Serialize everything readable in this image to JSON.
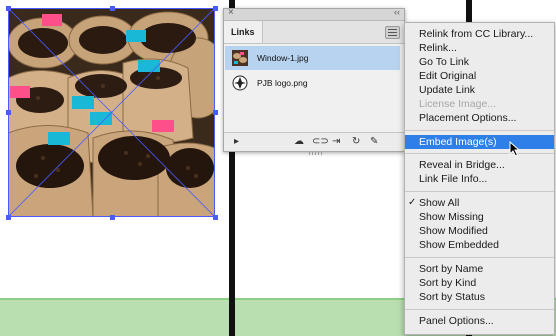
{
  "links_panel": {
    "tab_label": "Links",
    "items": [
      {
        "name": "Window-1.jpg",
        "selected": true
      },
      {
        "name": "PJB logo.png",
        "selected": false
      }
    ],
    "footer_tools": [
      "arrow",
      "cc-library",
      "relink",
      "go-to-link",
      "update-link",
      "edit-original"
    ]
  },
  "menu": {
    "items": [
      {
        "label": "Relink from CC Library...",
        "enabled": true
      },
      {
        "label": "Relink...",
        "enabled": true
      },
      {
        "label": "Go To Link",
        "enabled": true
      },
      {
        "label": "Edit Original",
        "enabled": true
      },
      {
        "label": "Update Link",
        "enabled": true
      },
      {
        "label": "License Image...",
        "enabled": false
      },
      {
        "label": "Placement Options...",
        "enabled": true
      },
      {
        "label": "Embed Image(s)",
        "enabled": true,
        "highlighted": true
      },
      {
        "label": "Reveal in Bridge...",
        "enabled": true
      },
      {
        "label": "Link File Info...",
        "enabled": true
      },
      {
        "label": "Show All",
        "enabled": true,
        "checked": true
      },
      {
        "label": "Show Missing",
        "enabled": true
      },
      {
        "label": "Show Modified",
        "enabled": true
      },
      {
        "label": "Show Embedded",
        "enabled": true
      },
      {
        "label": "Sort by Name",
        "enabled": true
      },
      {
        "label": "Sort by Kind",
        "enabled": true
      },
      {
        "label": "Sort by Status",
        "enabled": true
      },
      {
        "label": "Panel Options...",
        "enabled": true
      }
    ],
    "checkmark": "✓"
  },
  "colors": {
    "highlight": "#2f7fe8",
    "selection_frame": "#4a5cff",
    "green_band": "#b9dfb0"
  }
}
